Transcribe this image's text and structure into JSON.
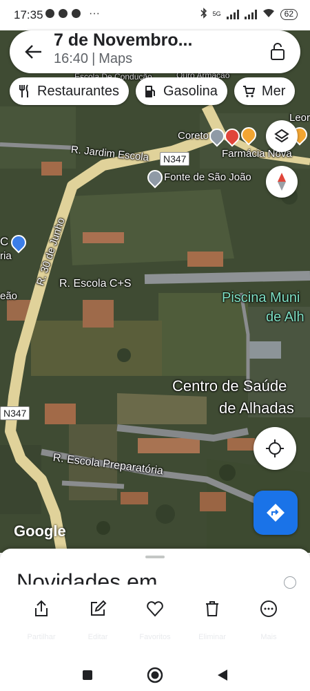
{
  "status_bar": {
    "time": "17:35",
    "network": "5G",
    "battery": "62"
  },
  "header": {
    "title": "7 de Novembro...",
    "time": "16:40",
    "separator": "|",
    "app": "Maps",
    "back_icon": "arrow-back-icon",
    "lock_icon": "lock-icon"
  },
  "chips": [
    {
      "label": "Restaurantes",
      "icon": "restaurant-icon"
    },
    {
      "label": "Gasolina",
      "icon": "gas-station-icon"
    },
    {
      "label": "Mer",
      "icon": "cart-icon"
    }
  ],
  "map": {
    "labels": {
      "escola_conducao": "Escola De Condução",
      "ouro_armacao": "Ouro Armação",
      "coreto": "Coreto",
      "leor": "Leor",
      "jardim_escola": "R. Jardim Escola",
      "n347_top": "N347",
      "farmacia": "Farmácia Nova",
      "fonte": "Fonte de São João",
      "rua_30_junho": "R. 30 de Junho",
      "c_label": "C",
      "ria": "ria",
      "escola_cs": "R. Escola C+S",
      "eao": "eão",
      "piscina_1": "Piscina Muni",
      "piscina_2": "de Alh",
      "centro_1": "Centro de Saúde",
      "centro_2": "de Alhadas",
      "n347_left": "N347",
      "escola_prep": "R. Escola Preparatória",
      "watermark": "Google"
    },
    "buttons": {
      "layers_icon": "layers-icon",
      "compass_icon": "compass-icon",
      "my_location_icon": "my-location-icon",
      "directions_icon": "directions-icon"
    }
  },
  "sheet": {
    "title": "Novidades em",
    "info_icon": "info-icon",
    "actions": [
      {
        "icon": "share-icon",
        "label": "Partilhar"
      },
      {
        "icon": "edit-icon",
        "label": "Editar"
      },
      {
        "icon": "heart-icon",
        "label": "Favoritos"
      },
      {
        "icon": "trash-icon",
        "label": "Eliminar"
      },
      {
        "icon": "more-icon",
        "label": "Mais"
      }
    ]
  },
  "nav_bar": {
    "recents_icon": "square-icon",
    "home_icon": "circle-icon",
    "back_icon": "triangle-back-icon"
  },
  "colors": {
    "accent": "#1a73e8",
    "map_green": "#3e4a33",
    "road": "#e0d29a"
  }
}
